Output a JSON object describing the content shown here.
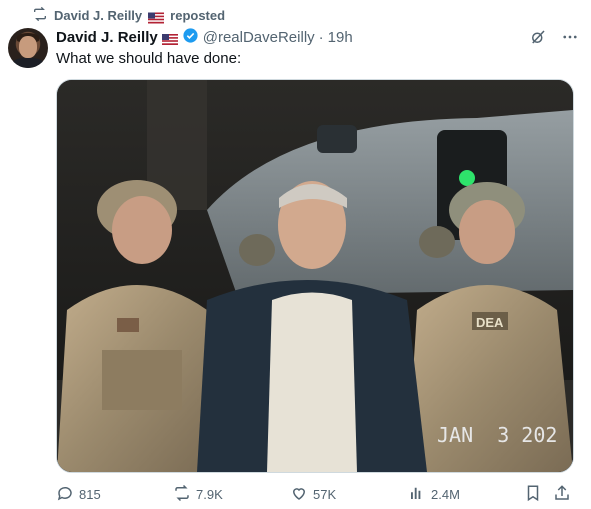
{
  "repost": {
    "label": "David J. Reilly 🇺🇸 reposted",
    "name": "David J. Reilly",
    "suffix": "reposted"
  },
  "tweet": {
    "author_name": "David J. Reilly",
    "handle": "@realDaveReilly",
    "separator": "·",
    "time": "19h",
    "text": "What we should have done:"
  },
  "media": {
    "timestamp_overlay": "JAN  3 202",
    "patch_text": "DEA"
  },
  "actions": {
    "replies": "815",
    "reposts": "7.9K",
    "likes": "57K",
    "views": "2.4M"
  },
  "colors": {
    "secondary_text": "#536471",
    "verified_blue": "#1d9bf0",
    "primary_text": "#0f1419"
  },
  "icons": [
    "repost-icon",
    "us-flag-icon",
    "verified-badge-icon",
    "grok-icon",
    "more-icon",
    "reply-icon",
    "views-icon",
    "bookmark-icon",
    "share-icon"
  ]
}
